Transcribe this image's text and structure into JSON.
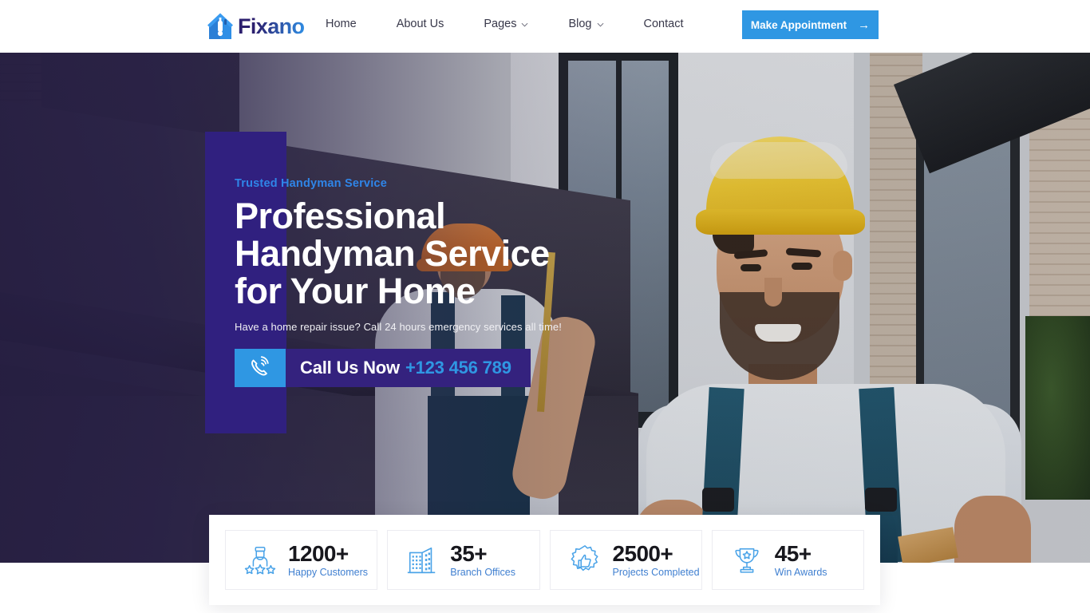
{
  "header": {
    "logo_text": "Fixano",
    "logo_icon": "house-tool-icon",
    "nav": [
      {
        "label": "Home",
        "has_dropdown": false
      },
      {
        "label": "About Us",
        "has_dropdown": false
      },
      {
        "label": "Pages",
        "has_dropdown": true
      },
      {
        "label": "Blog",
        "has_dropdown": true
      },
      {
        "label": "Contact",
        "has_dropdown": false
      }
    ],
    "cta": {
      "label": "Make Appointment",
      "icon": "arrow-right-icon",
      "color": "#2f97e3"
    }
  },
  "hero": {
    "tagline": "Trusted Handyman Service",
    "title_line1": "Professional",
    "title_line2": "Handyman Service",
    "title_line3": "for Your Home",
    "subtitle": "Have a home repair issue? Call 24 hours emergency services all time!",
    "call": {
      "icon": "phone-ring-icon",
      "label": "Call Us Now",
      "number": "+123 456 789",
      "icon_bg": "#2f97e3",
      "body_bg": "#34227e",
      "number_color": "#2f97e3"
    },
    "panel_color": "#30207f",
    "background_image": "handyman-yellow-hardhat-photo"
  },
  "stats": [
    {
      "icon": "customer-stars-icon",
      "value": "1200+",
      "label": "Happy Customers"
    },
    {
      "icon": "office-building-icon",
      "value": "35+",
      "label": "Branch Offices"
    },
    {
      "icon": "thumbs-up-badge-icon",
      "value": "2500+",
      "label": "Projects Completed"
    },
    {
      "icon": "trophy-star-icon",
      "value": "45+",
      "label": "Win Awards"
    }
  ],
  "theme": {
    "accent_blue": "#2f97e3",
    "deep_purple": "#30207f",
    "label_blue": "#3f7fd0",
    "dark_text": "#17171d"
  }
}
